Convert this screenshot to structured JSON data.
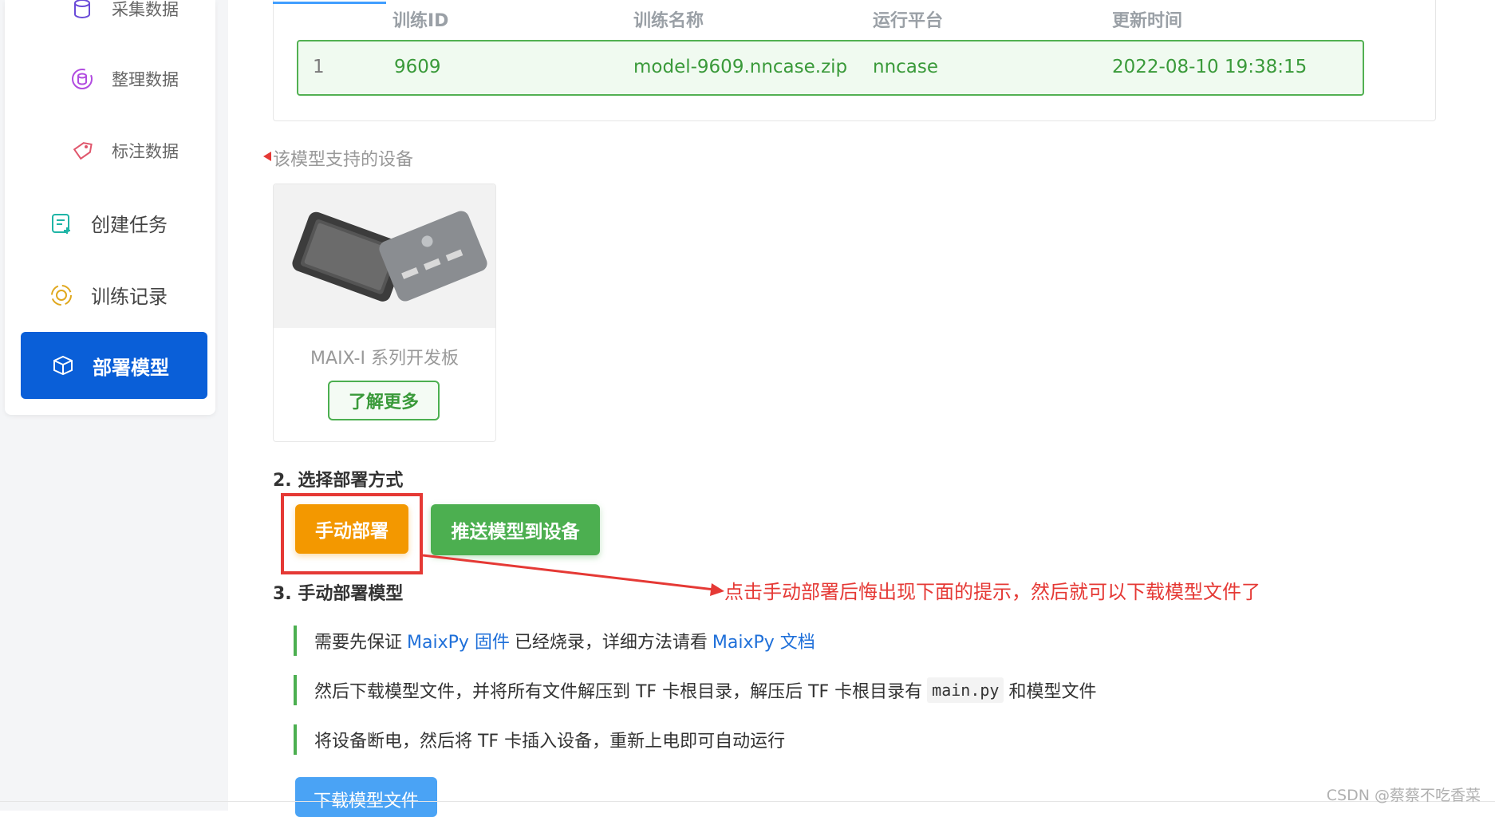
{
  "sidebar": {
    "items": [
      {
        "label": "采集数据",
        "icon": "database-icon"
      },
      {
        "label": "整理数据",
        "icon": "data-sync-icon"
      },
      {
        "label": "标注数据",
        "icon": "tag-icon"
      },
      {
        "label": "创建任务",
        "icon": "task-add-icon"
      },
      {
        "label": "训练记录",
        "icon": "training-cycle-icon"
      },
      {
        "label": "部署模型",
        "icon": "cube-icon",
        "active": true
      }
    ]
  },
  "table": {
    "headers": [
      "训练ID",
      "训练名称",
      "运行平台",
      "更新时间"
    ],
    "row": {
      "index": "1",
      "id": "9609",
      "name": "model-9609.nncase.zip",
      "platform": "nncase",
      "updated": "2022-08-10 19:38:15"
    }
  },
  "devices": {
    "section_label": "该模型支持的设备",
    "card": {
      "name": "MAIX-I 系列开发板",
      "learn_more": "了解更多"
    }
  },
  "step2": {
    "title": "2. 选择部署方式",
    "manual_button": "手动部署",
    "push_button": "推送模型到设备"
  },
  "annotation": {
    "text": "点击手动部署后悔出现下面的提示，然后就可以下载模型文件了"
  },
  "step3": {
    "title": "3. 手动部署模型",
    "line1": {
      "a": "需要先保证",
      "link1": "MaixPy 固件",
      "b": "已经烧录，详细方法请看",
      "link2": "MaixPy 文档"
    },
    "line2": {
      "a": "然后下载模型文件，并将所有文件解压到 TF 卡根目录，解压后 TF 卡根目录有",
      "code": "main.py",
      "b": "和模型文件"
    },
    "line3": {
      "a": "将设备断电，然后将 TF 卡插入设备，重新上电即可自动运行"
    },
    "download_button": "下载模型文件"
  },
  "watermark": "CSDN @蔡蔡不吃香菜",
  "colors": {
    "primary": "#0a5fd8",
    "success": "#4caf50",
    "warning": "#f39800",
    "annotation_red": "#e53935",
    "link": "#1e6fd9"
  }
}
